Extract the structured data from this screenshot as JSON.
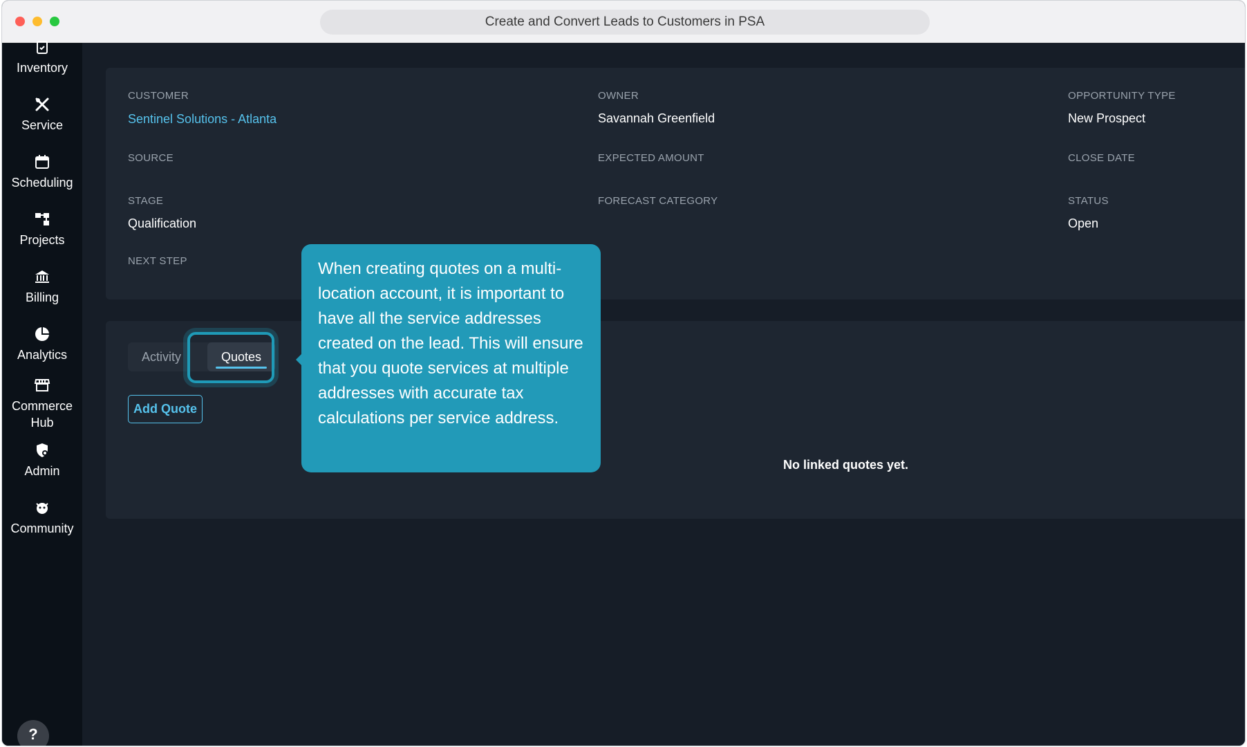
{
  "window": {
    "title": "Create and Convert Leads to Customers in PSA"
  },
  "sidebar": {
    "items": [
      {
        "label": "Inventory",
        "icon": "clipboard-check-icon"
      },
      {
        "label": "Service",
        "icon": "wrench-screwdriver-icon"
      },
      {
        "label": "Scheduling",
        "icon": "calendar-icon"
      },
      {
        "label": "Projects",
        "icon": "hierarchy-icon"
      },
      {
        "label": "Billing",
        "icon": "bank-icon"
      },
      {
        "label": "Analytics",
        "icon": "pie-chart-icon"
      },
      {
        "label": "Commerce Hub",
        "icon": "storefront-icon"
      },
      {
        "label": "Admin",
        "icon": "shield-user-icon"
      },
      {
        "label": "Community",
        "icon": "community-icon"
      }
    ],
    "help_label": "?"
  },
  "details": {
    "customer_label": "CUSTOMER",
    "customer_value": "Sentinel Solutions - Atlanta",
    "owner_label": "OWNER",
    "owner_value": "Savannah Greenfield",
    "opportunity_type_label": "OPPORTUNITY TYPE",
    "opportunity_type_value": "New Prospect",
    "source_label": "SOURCE",
    "expected_amount_label": "EXPECTED AMOUNT",
    "close_date_label": "CLOSE DATE",
    "stage_label": "STAGE",
    "stage_value": "Qualification",
    "forecast_category_label": "FORECAST CATEGORY",
    "status_label": "STATUS",
    "status_value": "Open",
    "next_step_label": "NEXT STEP"
  },
  "tabs": {
    "items": [
      "Activity",
      "Quotes"
    ],
    "active": "Quotes"
  },
  "quotes": {
    "add_button": "Add Quote",
    "empty_message": "No linked quotes yet."
  },
  "tooltip": {
    "text": "When creating quotes on a multi-location account, it is important to have all the service addresses created on the lead. This will ensure that you quote services at multiple addresses with accurate tax calculations per service address."
  },
  "colors": {
    "accent": "#56c2ec",
    "tooltip": "#229ab8",
    "background": "#161d27",
    "sidebar": "#0b1118"
  }
}
